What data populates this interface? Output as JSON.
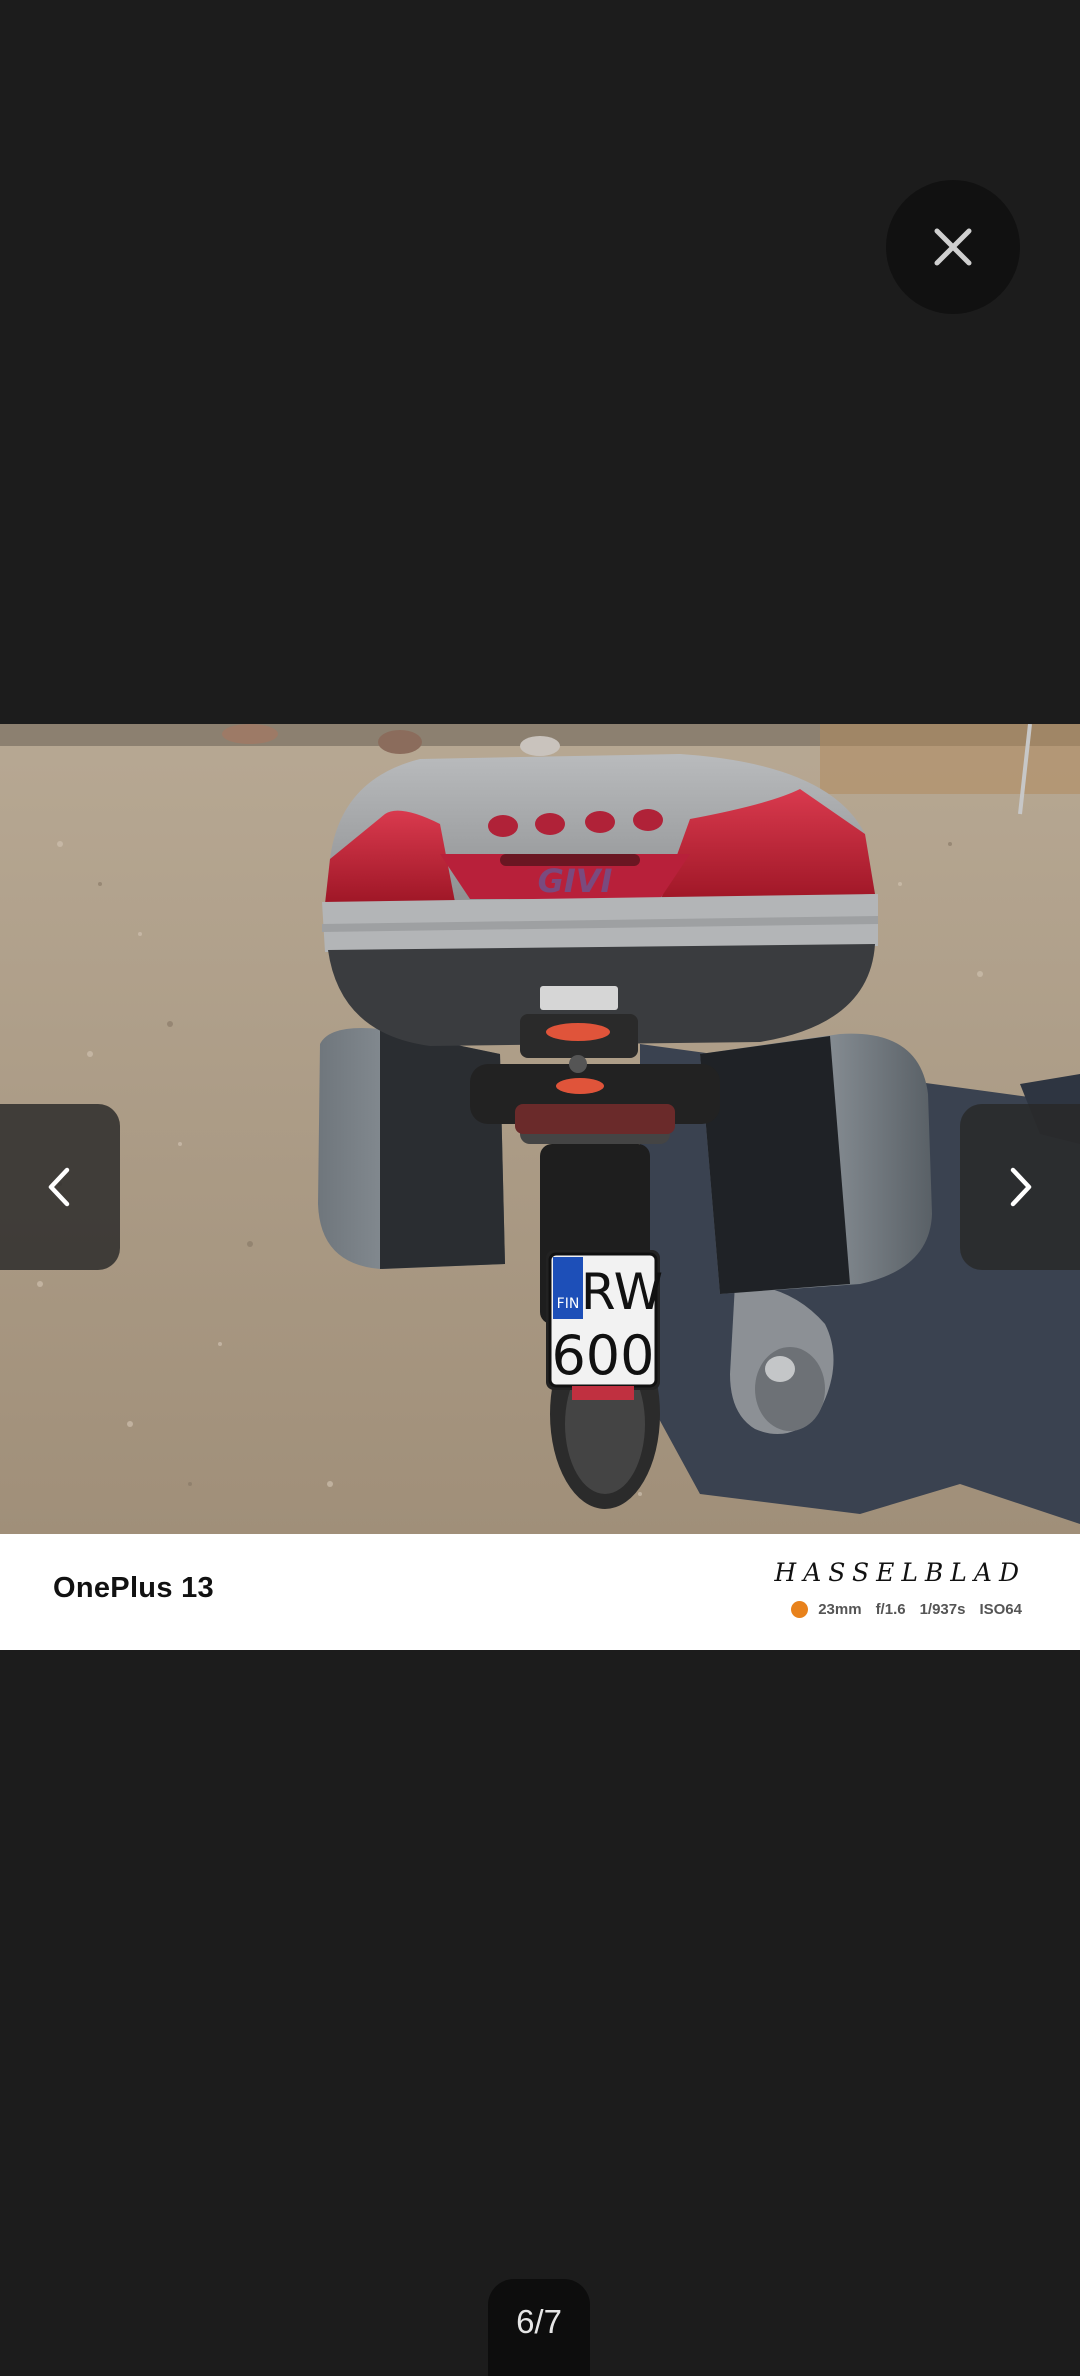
{
  "viewer": {
    "close_icon": "close-icon",
    "prev_icon": "chevron-left-icon",
    "next_icon": "chevron-right-icon",
    "counter": "6/7"
  },
  "photo": {
    "plate_country": "FIN",
    "plate_line1": "RW",
    "plate_line2": "600",
    "topcase_logo": "GIVI"
  },
  "watermark": {
    "device": "OnePlus 13",
    "brand": "HASSELBLAD",
    "focal": "23mm",
    "aperture": "f/1.6",
    "shutter": "1/937s",
    "iso": "ISO64",
    "accent_color": "#e8821c"
  }
}
